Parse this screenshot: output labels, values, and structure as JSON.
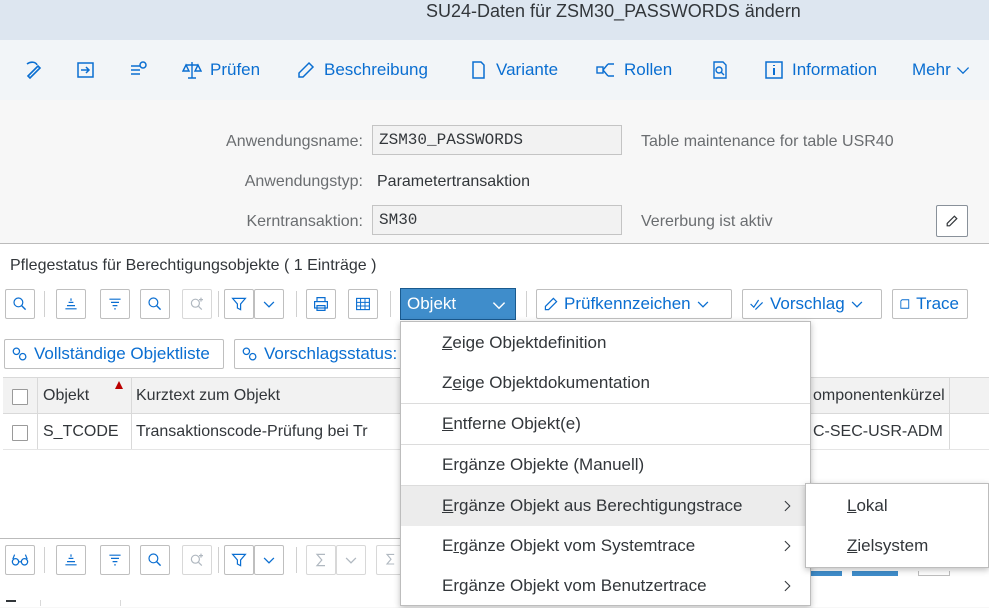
{
  "window": {
    "title": "SU24-Daten für ZSM30_PASSWORDS ändern"
  },
  "toolbar": {
    "buttons": [
      {
        "label": "",
        "icon": "edit-switch-icon"
      },
      {
        "label": "",
        "icon": "import-icon"
      },
      {
        "label": "",
        "icon": "transport-icon"
      },
      {
        "label": "Prüfen",
        "icon": "balance-icon"
      },
      {
        "label": "Beschreibung",
        "icon": "pencil-doc-icon"
      },
      {
        "label": "Variante",
        "icon": "document-icon"
      },
      {
        "label": "Rollen",
        "icon": "roles-icon"
      },
      {
        "label": "",
        "icon": "doc-search-icon"
      },
      {
        "label": "Information",
        "icon": "info-icon"
      },
      {
        "label": "Mehr",
        "icon": "chevron-down-icon"
      }
    ]
  },
  "form": {
    "app_name_label": "Anwendungsname:",
    "app_name_value": "ZSM30_PASSWORDS",
    "app_name_desc": "Table maintenance for table USR40",
    "app_type_label": "Anwendungstyp:",
    "app_type_value": "Parametertransaktion",
    "core_tx_label": "Kerntransaktion:",
    "core_tx_value": "SM30",
    "core_tx_desc": "Vererbung ist aktiv"
  },
  "panel": {
    "title": "Pflegestatus für Berechtigungsobjekte ( 1 Einträge )",
    "objekt_menu_label": "Objekt",
    "pruefkennzeichen_label": "Prüfkennzeichen",
    "vorschlag_label": "Vorschlag",
    "trace_label": "Trace",
    "vollstaendige_label": "Vollständige Objektliste",
    "vorschlagsstatus_label": "Vorschlagsstatus:"
  },
  "grid": {
    "columns": [
      "Objekt",
      "Kurztext zum Objekt",
      "omponentenkürzel"
    ],
    "rows": [
      {
        "objekt": "S_TCODE",
        "kurztext": "Transaktionscode-Prüfung bei Tr",
        "komponente": "C-SEC-USR-ADM"
      }
    ]
  },
  "menu": {
    "items": [
      {
        "pre": "",
        "ul": "Z",
        "post": "eige Objektdefinition",
        "submenu": false
      },
      {
        "pre": "Z",
        "ul": "e",
        "post": "ige Objektdokumentation",
        "submenu": false
      },
      {
        "pre": "",
        "ul": "E",
        "post": "ntferne Objekt(e)",
        "submenu": false
      },
      {
        "pre": "Er",
        "ul": "g",
        "post": "änze Objekte (Manuell)",
        "submenu": false
      },
      {
        "pre": "",
        "ul": "E",
        "post": "rgänze Objekt aus Berechtigungstrace",
        "submenu": true
      },
      {
        "pre": "E",
        "ul": "r",
        "post": "gänze Objekt vom Systemtrace",
        "submenu": true
      },
      {
        "pre": "Ergänze Objekt vom Benutzertrace",
        "ul": "",
        "post": "",
        "submenu": true
      }
    ],
    "submenu": [
      {
        "pre": "",
        "ul": "L",
        "post": "okal"
      },
      {
        "pre": "",
        "ul": "Z",
        "post": "ielsystem"
      }
    ]
  },
  "colors": {
    "accent": "#0a6ed1",
    "selected": "#3f8dcb",
    "sort_arrow": "#bb0000"
  }
}
